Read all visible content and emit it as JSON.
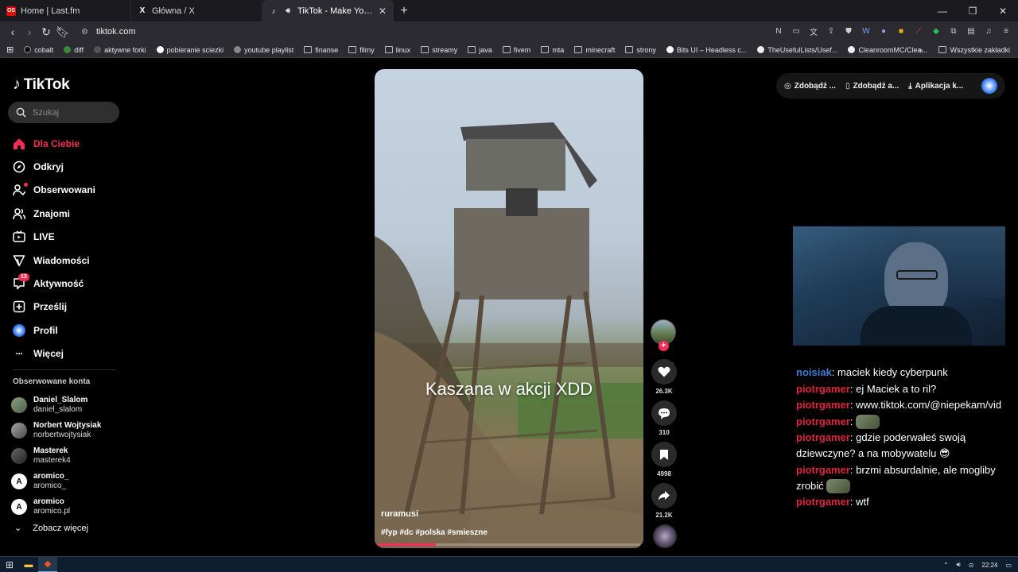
{
  "browser": {
    "tabs": [
      {
        "label": "Home | Last.fm",
        "favicon": "lastfm-icon",
        "favicon_text": "OS",
        "favicon_color": "#d51007",
        "active": false
      },
      {
        "label": "Główna / X",
        "favicon": "x-icon",
        "favicon_text": "X",
        "favicon_color": "#1b1b1f",
        "active": false
      },
      {
        "label": "TikTok - Make Your Day",
        "favicon": "tiktok-icon",
        "favicon_text": "♪",
        "favicon_color": "#000000",
        "active": true
      }
    ],
    "address": "tiktok.com",
    "bookmarks": [
      "cobalt",
      "diff",
      "aktywne forki",
      "pobieranie sciezki",
      "youtube playlist",
      "finanse",
      "filmy",
      "linux",
      "streamy",
      "java",
      "fivem",
      "mta",
      "minecraft",
      "strony",
      "Bits UI – Headless c...",
      "TheUsefulLists/Usef...",
      "CleanroomMC/Clea..."
    ],
    "all_bookmarks_label": "Wszystkie zakładki"
  },
  "sidebar": {
    "logo": "TikTok",
    "search_placeholder": "Szukaj",
    "nav": [
      {
        "label": "Dla Ciebie",
        "icon": "home-icon",
        "active": true
      },
      {
        "label": "Odkryj",
        "icon": "compass-icon"
      },
      {
        "label": "Obserwowani",
        "icon": "following-icon"
      },
      {
        "label": "Znajomi",
        "icon": "friends-icon"
      },
      {
        "label": "LIVE",
        "icon": "live-icon"
      },
      {
        "label": "Wiadomości",
        "icon": "send-icon"
      },
      {
        "label": "Aktywność",
        "icon": "inbox-icon",
        "badge": "13"
      },
      {
        "label": "Prześlij",
        "icon": "upload-icon"
      },
      {
        "label": "Profil",
        "icon": "profile-icon"
      },
      {
        "label": "Więcej",
        "icon": "more-icon"
      }
    ],
    "following_header": "Obserwowane konta",
    "following": [
      {
        "name": "Daniel_Slalom",
        "handle": "daniel_slalom",
        "avatar_color": "#6f8a6a"
      },
      {
        "name": "Norbert Wojtysiak",
        "handle": "norbertwojtysiak",
        "avatar_color": "#777777"
      },
      {
        "name": "Masterek",
        "handle": "masterek4",
        "avatar_color": "#444444"
      },
      {
        "name": "aromico_",
        "handle": "aromico_",
        "avatar_color": "#ffffff"
      },
      {
        "name": "aromico",
        "handle": "aromico.pl",
        "avatar_color": "#ffffff"
      }
    ],
    "see_more": "Zobacz więcej"
  },
  "video": {
    "caption": "Kaszana w akcji XDD",
    "author": "ruramusi",
    "hashtags": "#fyp #dc #polska #smieszne",
    "progress": 0.22
  },
  "actions": {
    "likes": "26.3K",
    "comments": "310",
    "bookmarks": "4998",
    "shares": "21.2K"
  },
  "top_bar": {
    "items": [
      "Zdobądź ...",
      "Zdobądź a...",
      "Aplikacja k..."
    ]
  },
  "chat": {
    "messages": [
      {
        "user": "noisiak",
        "text": "maciek kiedy cyberpunk",
        "color": "#3b7dd8"
      },
      {
        "user": "piotrgamer",
        "text": "ej Maciek a to ril?",
        "color": "#e0243a"
      },
      {
        "user": "piotrgamer",
        "text": "www.tiktok.com/@niepekam/vid",
        "color": "#e0243a",
        "nowrap": true
      },
      {
        "user": "piotrgamer",
        "text": "",
        "color": "#e0243a",
        "emote": true
      },
      {
        "user": "piotrgamer",
        "text": "gdzie poderwałeś swoją dziewczyne? a na mobywatelu 😎",
        "color": "#e0243a"
      },
      {
        "user": "piotrgamer",
        "text": "brzmi absurdalnie, ale mogliby zrobić",
        "color": "#e0243a",
        "emote": true
      },
      {
        "user": "piotrgamer",
        "text": "wtf",
        "color": "#e0243a"
      }
    ]
  },
  "taskbar": {
    "time": "22:24"
  }
}
